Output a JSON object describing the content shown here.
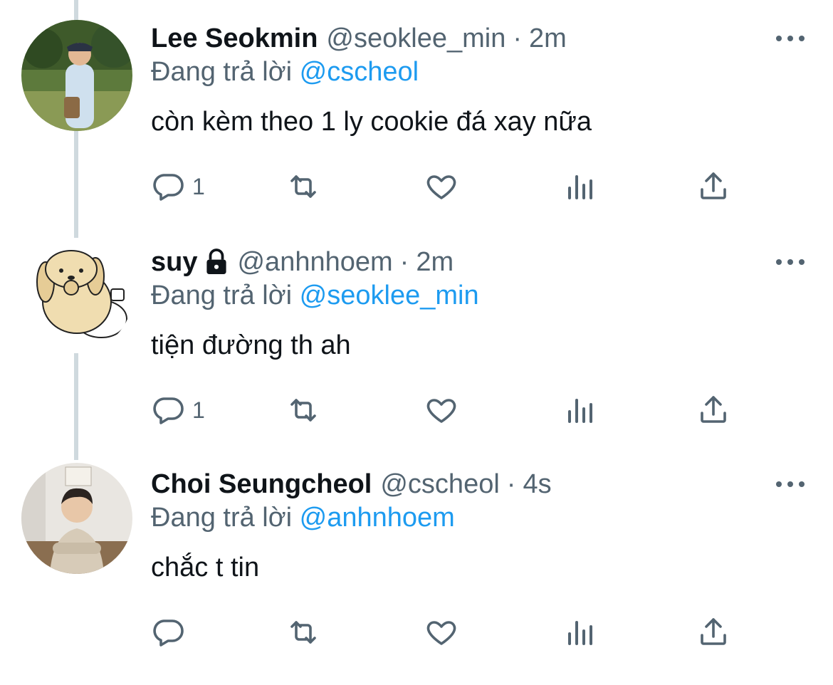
{
  "colors": {
    "text": "#0f1419",
    "secondary": "#536471",
    "mention": "#1d9bf0",
    "thread_line": "#cfd9de"
  },
  "reply_prefix": "Đang trả lời",
  "tweets": [
    {
      "display_name": "Lee Seokmin",
      "handle": "@seoklee_min",
      "separator": "·",
      "time": "2m",
      "reply_to": "@cscheol",
      "text": "còn kèm theo 1 ly cookie đá xay nữa",
      "reply_count": "1",
      "locked": false,
      "avatar": "photo-outdoor-avatar"
    },
    {
      "display_name": "suy",
      "handle": "@anhnhoem",
      "separator": "·",
      "time": "2m",
      "reply_to": "@seoklee_min",
      "text": "tiện đường th ah",
      "reply_count": "1",
      "locked": true,
      "avatar": "puppy-cartoon-avatar"
    },
    {
      "display_name": "Choi Seungcheol",
      "handle": "@cscheol",
      "separator": "·",
      "time": "4s",
      "reply_to": "@anhnhoem",
      "text": "chắc t tin",
      "reply_count": "",
      "locked": false,
      "avatar": "photo-indoor-avatar"
    }
  ],
  "action_icons": [
    "reply-icon",
    "retweet-icon",
    "like-icon",
    "analytics-icon",
    "share-icon"
  ]
}
